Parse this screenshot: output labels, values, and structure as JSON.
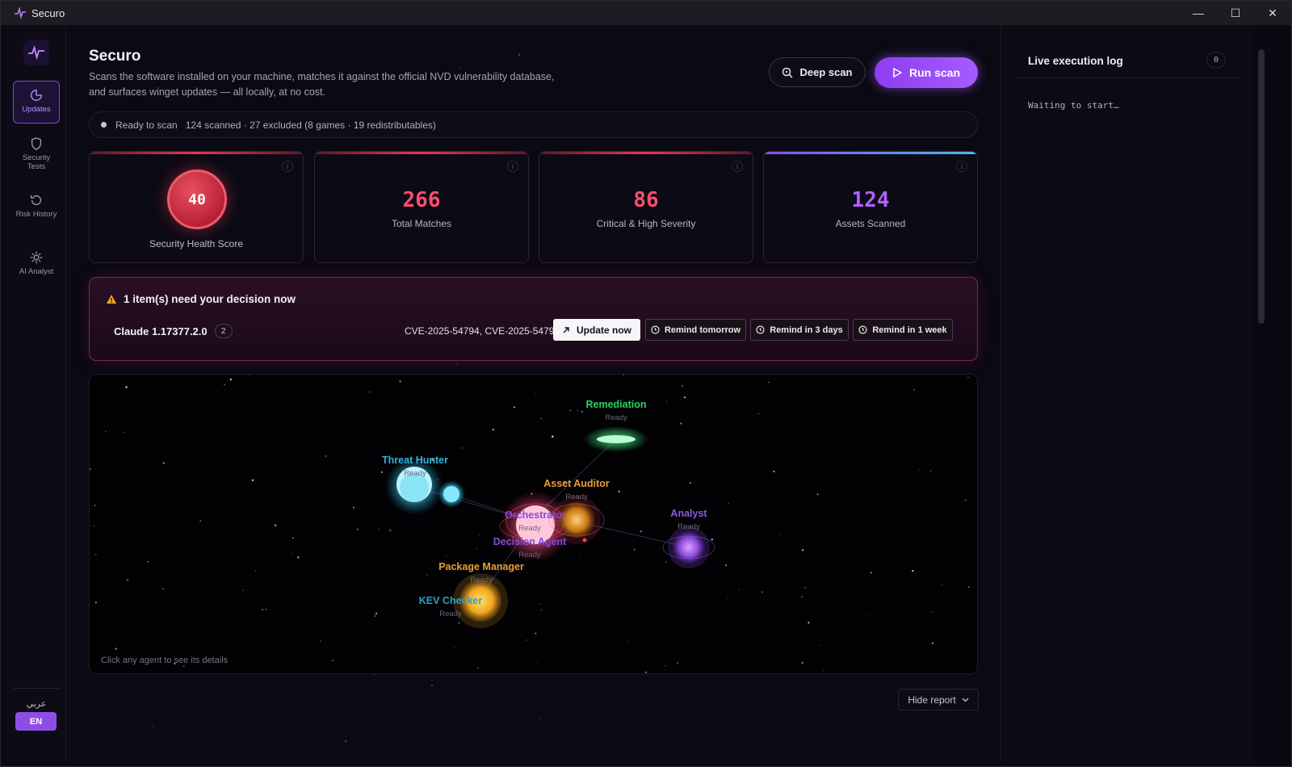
{
  "window": {
    "title": "Securo",
    "controls": [
      "minimize-icon",
      "maximize-icon",
      "close-icon"
    ]
  },
  "sidebar": {
    "items": [
      {
        "label": "Updates",
        "icon": "refresh-pie-icon",
        "active": true
      },
      {
        "label": "Security Tests",
        "icon": "shield-icon",
        "active": false
      },
      {
        "label": "Risk History",
        "icon": "history-icon",
        "active": false
      },
      {
        "label": "AI Analyst",
        "icon": "sun-gear-icon",
        "active": false
      }
    ],
    "lang_ar": "عربي",
    "lang_en": "EN"
  },
  "header": {
    "title": "Securo",
    "description": "Scans the software installed on your machine, matches it against the official NVD vulnerability database, and surfaces winget updates — all locally, at no cost.",
    "deep_scan_label": "Deep scan",
    "run_scan_label": "Run scan"
  },
  "status": {
    "state": "Ready to scan",
    "detail": "124 scanned · 27 excluded (8 games · 19 redistributables)"
  },
  "cards": {
    "health": {
      "value": "40",
      "label": "Security Health Score",
      "info": "i"
    },
    "matches": {
      "value": "266",
      "label": "Total Matches",
      "info": "i"
    },
    "critical": {
      "value": "86",
      "label": "Critical & High Severity",
      "info": "i"
    },
    "assets": {
      "value": "124",
      "label": "Assets Scanned",
      "info": "i"
    }
  },
  "decision": {
    "title": "1 item(s) need your decision now",
    "app_name": "Claude 1.17377.2.0",
    "count": "2",
    "cves": "CVE-2025-54794, CVE-2025-54795",
    "update_label": "Update now",
    "remind_tomorrow": "Remind tomorrow",
    "remind_3days": "Remind in 3 days",
    "remind_week": "Remind in 1 week"
  },
  "agents": {
    "remediation": {
      "name": "Remediation",
      "status": "Ready"
    },
    "threat_hunter": {
      "name": "Threat Hunter",
      "status": "Ready"
    },
    "asset_auditor": {
      "name": "Asset Auditor",
      "status": "Ready"
    },
    "orchestrator": {
      "name": "Orchestrator",
      "status": "Ready"
    },
    "decision_agent": {
      "name": "Decision Agent",
      "status": "Ready"
    },
    "analyst": {
      "name": "Analyst",
      "status": "Ready"
    },
    "package_manager": {
      "name": "Package Manager",
      "status": "Ready"
    },
    "kev_checker": {
      "name": "KEV Checker",
      "status": "Ready"
    },
    "hint": "Click any agent to see its details"
  },
  "hide_report_label": "Hide report",
  "log": {
    "title": "Live execution log",
    "count": "0",
    "empty": "Waiting to start…"
  },
  "colors": {
    "accent": "#9a4cf6",
    "critical": "#ff4d6d",
    "assets": "#b061ff",
    "health": "#e23a52"
  }
}
